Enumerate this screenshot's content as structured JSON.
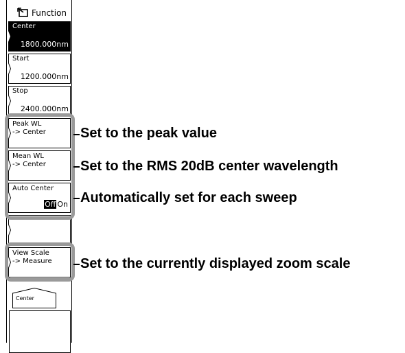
{
  "menu": {
    "title": "Function",
    "keys": [
      {
        "label": "Center",
        "value": "1800.000nm",
        "selected": true
      },
      {
        "label": "Start",
        "value": "1200.000nm"
      },
      {
        "label": "Stop",
        "value": "2400.000nm"
      },
      {
        "label": "Peak WL\n-> Center"
      },
      {
        "label": "Mean WL\n-> Center"
      },
      {
        "label": "Auto Center",
        "toggle_off": "Off",
        "toggle_on": "On"
      },
      {
        "label": ""
      },
      {
        "label": "View Scale\n-> Measure"
      }
    ],
    "sub_tab": "Center"
  },
  "annotations": [
    "Set to the peak value",
    "Set to the RMS 20dB center wavelength",
    "Automatically set for each sweep",
    "Set to the currently displayed zoom scale"
  ],
  "colors": {
    "group_outline": "#9a9a9a",
    "selected_key": "#000000"
  }
}
